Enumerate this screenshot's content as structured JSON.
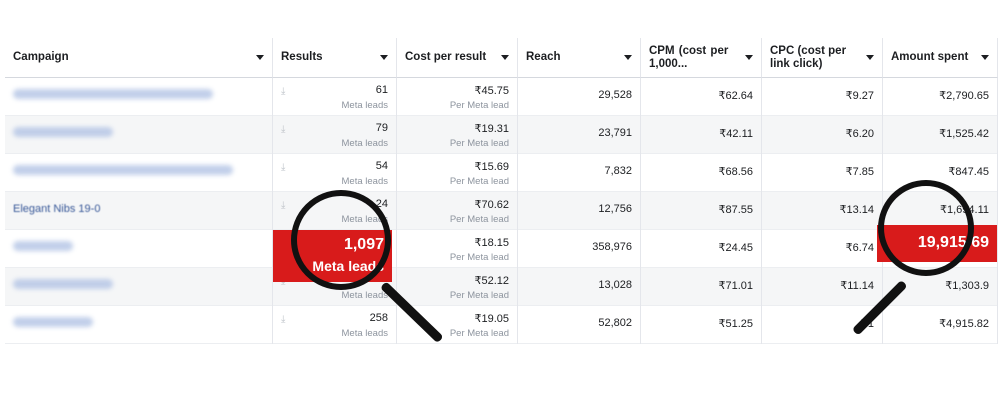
{
  "columns": [
    {
      "label": "Campaign"
    },
    {
      "label": "Results"
    },
    {
      "label": "Cost per result"
    },
    {
      "label": "Reach"
    },
    {
      "label": "CPM (cost per 1,000..."
    },
    {
      "label": "CPC (cost per link click)"
    },
    {
      "label": "Amount spent"
    }
  ],
  "rows": [
    {
      "campaign": "",
      "results": "61",
      "results_sub": "Meta leads",
      "cpr": "₹45.75",
      "cpr_sub": "Per Meta lead",
      "reach": "29,528",
      "cpm": "₹62.64",
      "cpc": "₹9.27",
      "spent": "₹2,790.65"
    },
    {
      "campaign": "",
      "results": "79",
      "results_sub": "Meta leads",
      "cpr": "₹19.31",
      "cpr_sub": "Per Meta lead",
      "reach": "23,791",
      "cpm": "₹42.11",
      "cpc": "₹6.20",
      "spent": "₹1,525.42"
    },
    {
      "campaign": "",
      "results": "54",
      "results_sub": "Meta leads",
      "cpr": "₹15.69",
      "cpr_sub": "Per Meta lead",
      "reach": "7,832",
      "cpm": "₹68.56",
      "cpc": "₹7.85",
      "spent": "₹847.45"
    },
    {
      "campaign": "Elegant Nibs 19-0",
      "results": "24",
      "results_sub": "Meta leads",
      "cpr": "₹70.62",
      "cpr_sub": "Per Meta lead",
      "reach": "12,756",
      "cpm": "₹87.55",
      "cpc": "₹13.14",
      "spent": "₹1,694.11"
    },
    {
      "campaign": "",
      "results": "1,097",
      "results_sub": "Meta leads",
      "cpr": "₹18.15",
      "cpr_sub": "Per Meta lead",
      "reach": "358,976",
      "cpm": "₹24.45",
      "cpc": "₹6.74",
      "spent": "19,915.69"
    },
    {
      "campaign": "",
      "results": "",
      "results_sub": "Meta leads",
      "cpr": "₹52.12",
      "cpr_sub": "Per Meta lead",
      "reach": "13,028",
      "cpm": "₹71.01",
      "cpc": "₹11.14",
      "spent": "₹1,303.9"
    },
    {
      "campaign": "",
      "results": "258",
      "results_sub": "Meta leads",
      "cpr": "₹19.05",
      "cpr_sub": "Per Meta lead",
      "reach": "52,802",
      "cpm": "₹51.25",
      "cpc": "₹1",
      "spent": "₹4,915.82"
    }
  ],
  "highlights": {
    "results_value": "1,097",
    "results_label": "Meta leads",
    "spent_value": "19,915.69"
  },
  "colors": {
    "highlight": "#d81b1b",
    "link": "#385898"
  }
}
